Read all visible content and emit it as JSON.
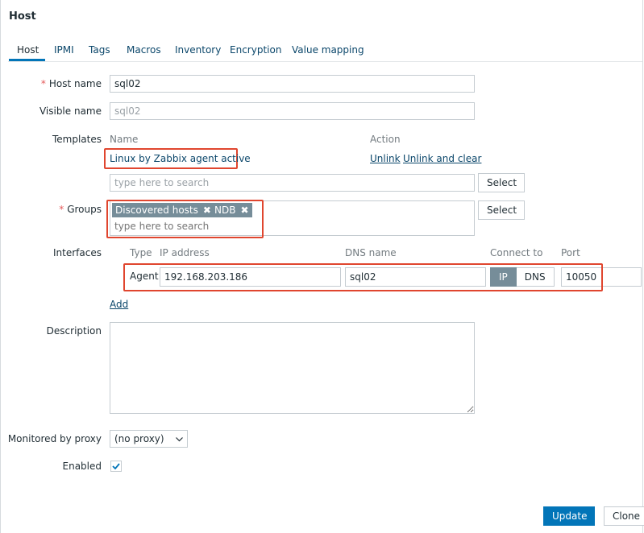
{
  "header": {
    "title": "Host"
  },
  "tabs": [
    {
      "label": "Host",
      "active": true
    },
    {
      "label": "IPMI"
    },
    {
      "label": "Tags"
    },
    {
      "label": "Macros"
    },
    {
      "label": "Inventory"
    },
    {
      "label": "Encryption"
    },
    {
      "label": "Value mapping"
    }
  ],
  "form": {
    "host_name": {
      "label": "Host name",
      "value": "sql02"
    },
    "visible_name": {
      "label": "Visible name",
      "value": "sql02"
    },
    "templates": {
      "label": "Templates",
      "col_name": "Name",
      "col_action": "Action",
      "items": [
        {
          "name": "Linux by Zabbix agent active",
          "unlink": "Unlink",
          "unlink_clear": "Unlink and clear"
        }
      ],
      "search_placeholder": "type here to search",
      "select_label": "Select"
    },
    "groups": {
      "label": "Groups",
      "tags": [
        "Discovered hosts",
        "NDB"
      ],
      "remove_glyph": "✖",
      "search_placeholder": "type here to search",
      "select_label": "Select"
    },
    "interfaces": {
      "label": "Interfaces",
      "col_type": "Type",
      "col_ip": "IP address",
      "col_dns": "DNS name",
      "col_connect": "Connect to",
      "col_port": "Port",
      "rows": [
        {
          "type": "Agent",
          "ip": "192.168.203.186",
          "dns": "sql02",
          "connect_ip": "IP",
          "connect_dns": "DNS",
          "connect_selected": "IP",
          "port": "10050"
        }
      ],
      "add_label": "Add"
    },
    "description": {
      "label": "Description",
      "value": ""
    },
    "proxy": {
      "label": "Monitored by proxy",
      "value": "(no proxy)",
      "icon": "chevron-down-icon"
    },
    "enabled": {
      "label": "Enabled",
      "checked": true,
      "icon": "checkmark-icon"
    }
  },
  "buttons": {
    "update": "Update",
    "clone": "Clone"
  },
  "colors": {
    "accent": "#0275b8",
    "link": "#0a466a",
    "tag_bg": "#768d99",
    "highlight": "#e0462f",
    "required": "#e45959"
  }
}
